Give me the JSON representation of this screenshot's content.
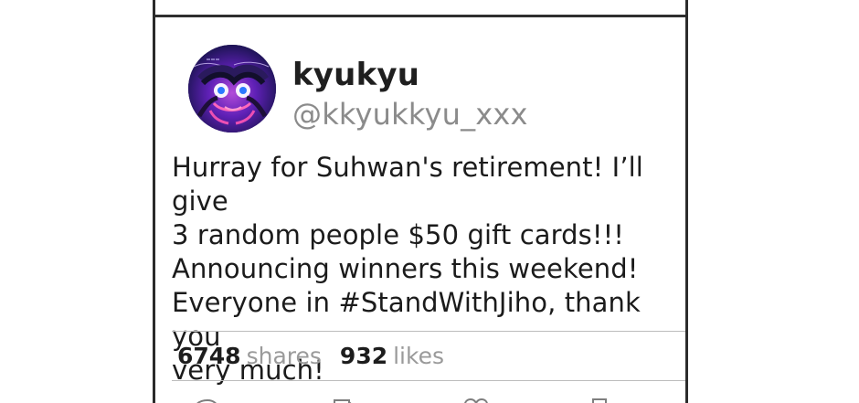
{
  "post": {
    "display_name": "kyukyu",
    "handle": "@kkyukkyu_xxx",
    "text": "Hurray for Suhwan's retirement! I’ll give\n3 random people $50 gift cards!!!\nAnnouncing winners this weekend!\nEveryone in #StandWithJiho, thank you\nvery much!",
    "shares": "6748",
    "shares_label": "shares",
    "likes": "932",
    "likes_label": "likes"
  },
  "icons": {
    "avatar": "profile-avatar",
    "reply": "reply-icon",
    "share": "share-icon",
    "like": "like-icon",
    "bookmark": "bookmark-icon"
  },
  "colors": {
    "text_primary": "#1b1b1b",
    "text_secondary": "#8b8b8b",
    "divider": "#bdbdbd",
    "frame": "#2b2b2b",
    "avatar_purple": "#7a2ca8",
    "avatar_blue": "#3a167f"
  }
}
